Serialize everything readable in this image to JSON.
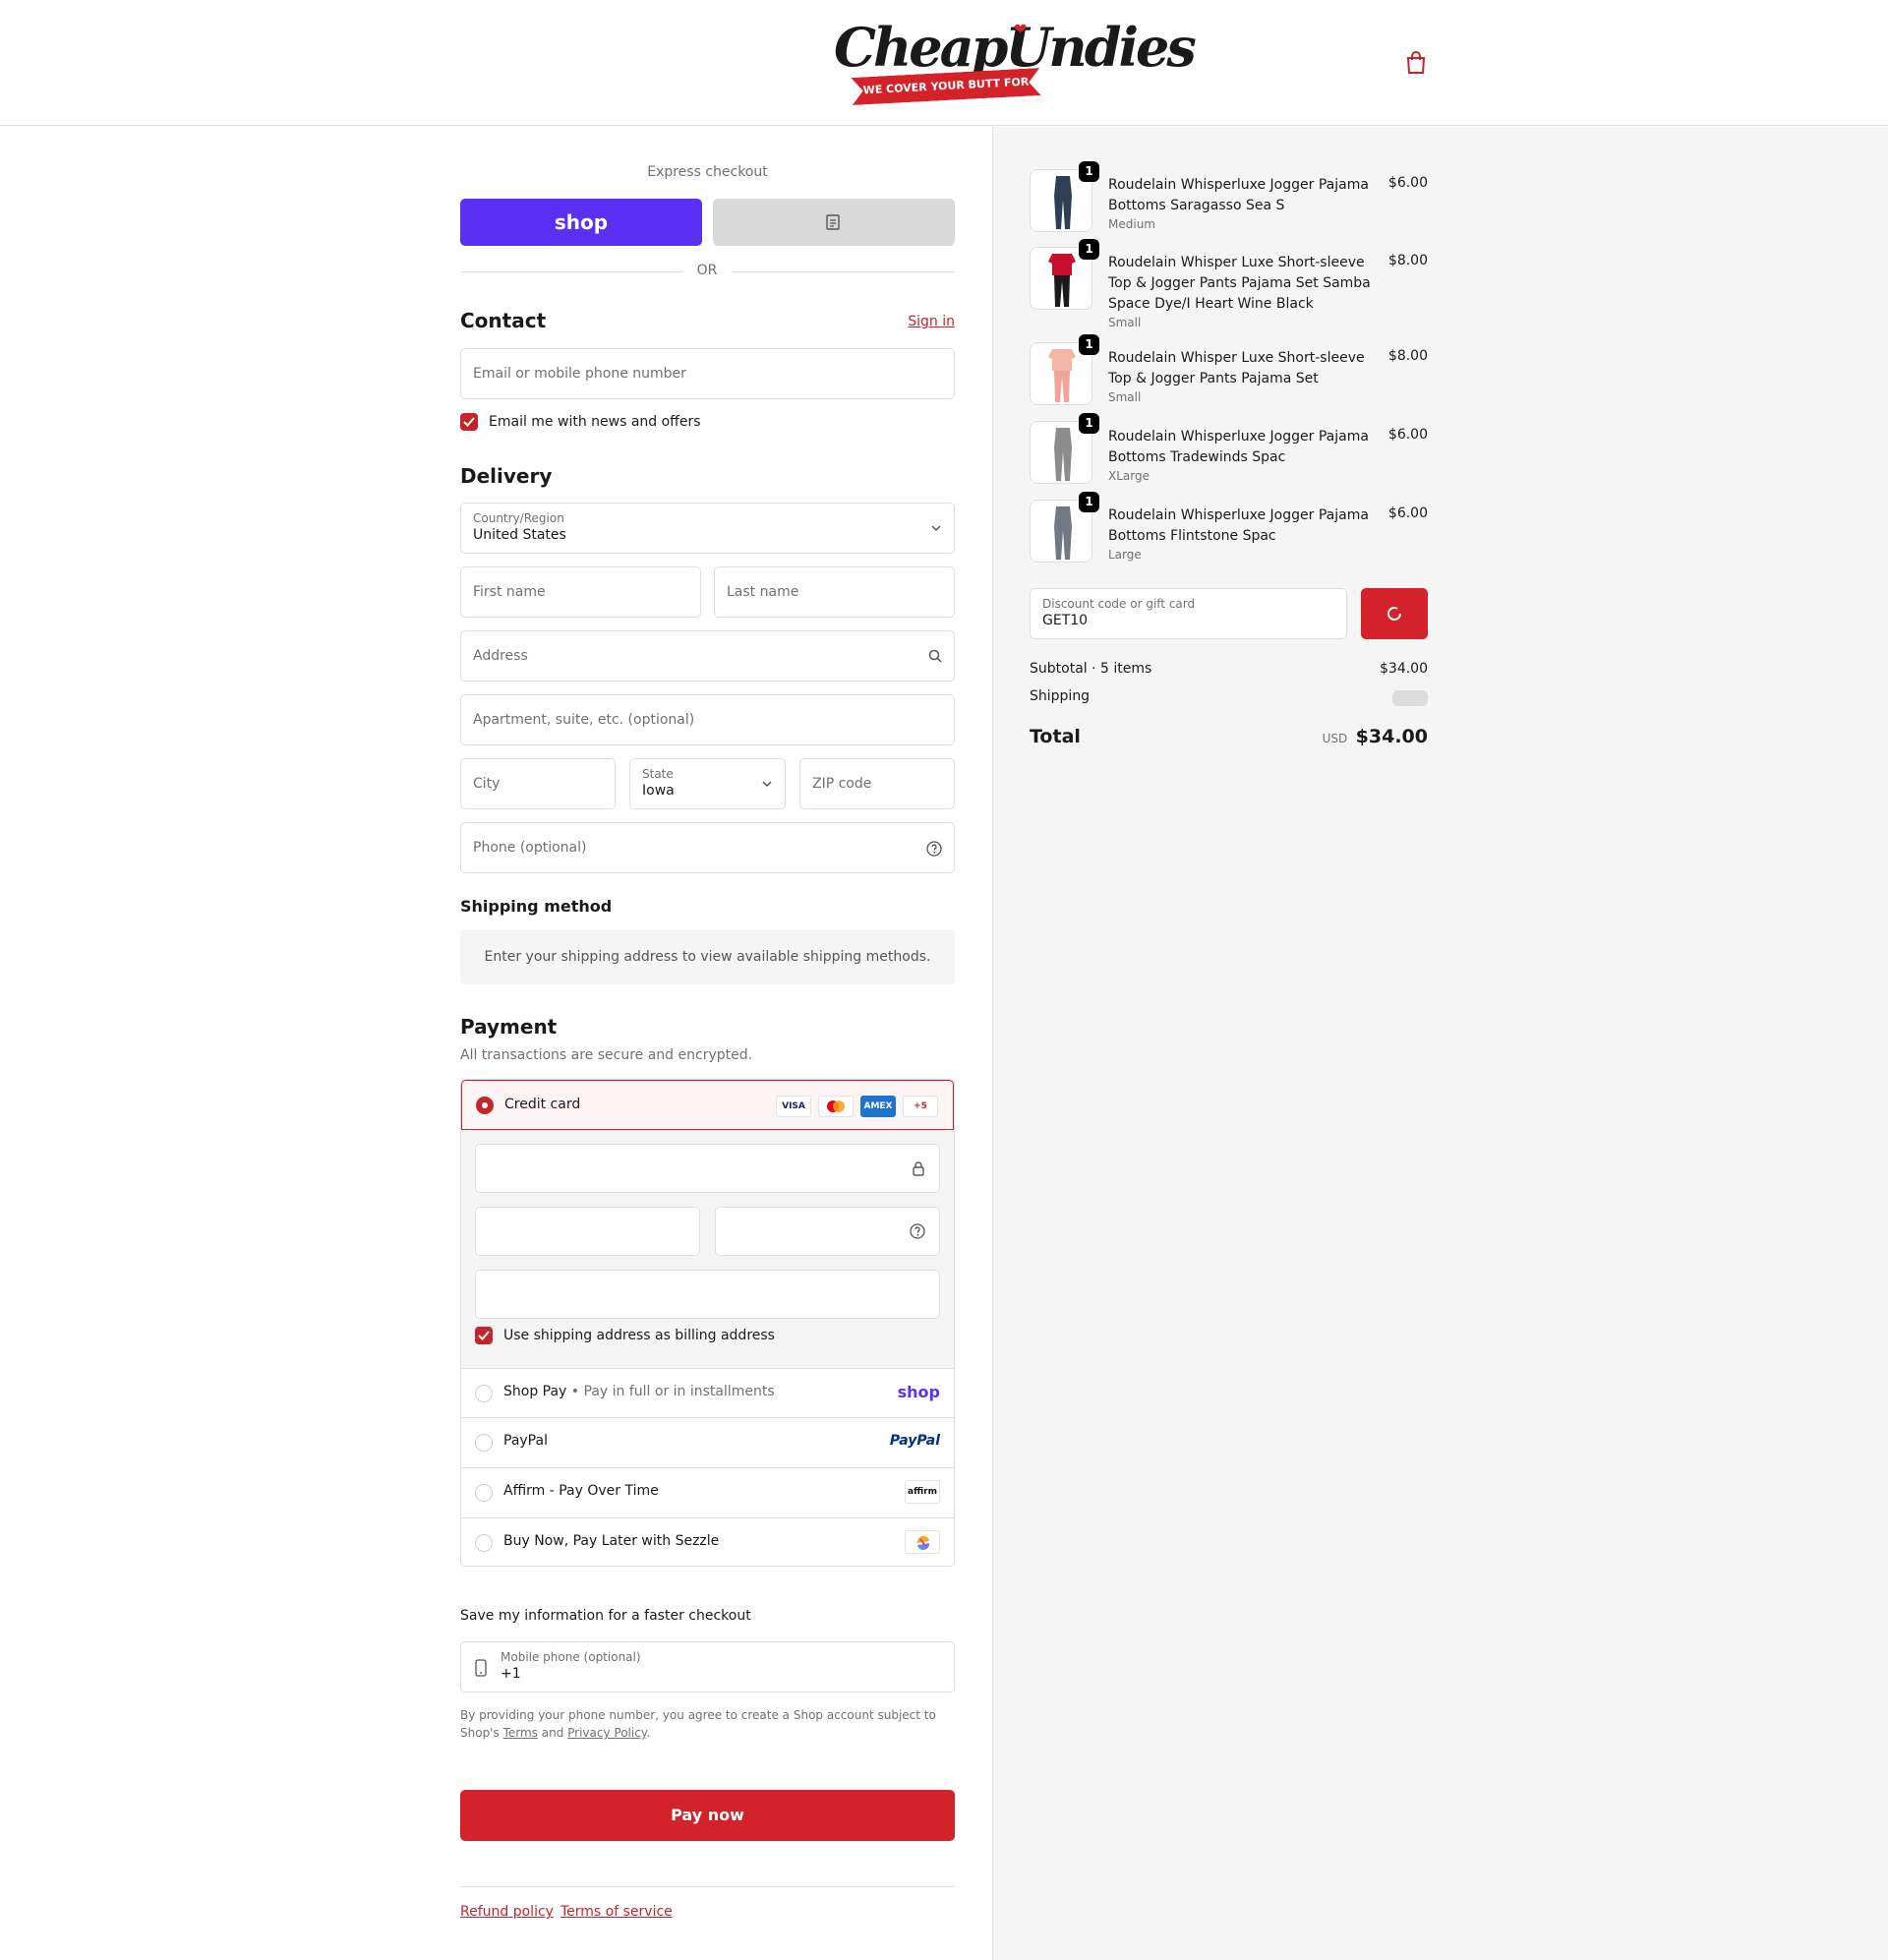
{
  "header": {
    "logo_text": "CheapUndies",
    "logo_tagline": "WE COVER YOUR BUTT FOR LESS"
  },
  "express": {
    "label": "Express checkout",
    "shop_pay_label": "shop",
    "divider": "OR"
  },
  "contact": {
    "title": "Contact",
    "sign_in": "Sign in",
    "email_placeholder": "Email or mobile phone number",
    "news_label": "Email me with news and offers"
  },
  "delivery": {
    "title": "Delivery",
    "country_label": "Country/Region",
    "country_value": "United States",
    "first_name_placeholder": "First name",
    "last_name_placeholder": "Last name",
    "address_placeholder": "Address",
    "apartment_placeholder": "Apartment, suite, etc. (optional)",
    "city_placeholder": "City",
    "state_label": "State",
    "state_value": "Iowa",
    "zip_placeholder": "ZIP code",
    "phone_placeholder": "Phone (optional)"
  },
  "shipping": {
    "title": "Shipping method",
    "message": "Enter your shipping address to view available shipping methods."
  },
  "payment": {
    "title": "Payment",
    "subtitle": "All transactions are secure and encrypted.",
    "credit_card_label": "Credit card",
    "card_logos": [
      "VISA",
      "",
      "AMEX",
      "+5"
    ],
    "billing_label": "Use shipping address as billing address",
    "shop_pay_label": "Shop Pay",
    "shop_pay_sub": "Pay in full or in installments",
    "shop_pay_logo": "shop",
    "paypal_label": "PayPal",
    "paypal_logo": "PayPal",
    "affirm_label": "Affirm - Pay Over Time",
    "affirm_logo": "affirm",
    "sezzle_label": "Buy Now, Pay Later with Sezzle"
  },
  "save_info": {
    "title": "Save my information for a faster checkout",
    "mobile_label": "Mobile phone (optional)",
    "mobile_value": "+1",
    "legal_prefix": "By providing your phone number, you agree to create a Shop account subject to Shop's",
    "terms": "Terms",
    "and": "and",
    "privacy": "Privacy Policy",
    "period": "."
  },
  "pay_now": "Pay now",
  "footer": {
    "refund": "Refund policy",
    "terms": "Terms of service"
  },
  "order": {
    "items": [
      {
        "qty": "1",
        "name": "Roudelain Whisperluxe Jogger Pajama Bottoms Saragasso Sea S",
        "variant": "Medium",
        "price": "$6.00",
        "color": "#2e3e55"
      },
      {
        "qty": "1",
        "name": "Roudelain Whisper Luxe Short-sleeve Top & Jogger Pants Pajama Set Samba Space Dye/I Heart Wine Black",
        "variant": "Small",
        "price": "$8.00",
        "color": "#c8102e"
      },
      {
        "qty": "1",
        "name": "Roudelain Whisper Luxe Short-sleeve Top & Jogger Pants Pajama Set",
        "variant": "Small",
        "price": "$8.00",
        "color": "#f2b5a8"
      },
      {
        "qty": "1",
        "name": "Roudelain Whisperluxe Jogger Pajama Bottoms Tradewinds Spac",
        "variant": "XLarge",
        "price": "$6.00",
        "color": "#8c8c8c"
      },
      {
        "qty": "1",
        "name": "Roudelain Whisperluxe Jogger Pajama Bottoms Flintstone Spac",
        "variant": "Large",
        "price": "$6.00",
        "color": "#707984"
      }
    ],
    "discount_label": "Discount code or gift card",
    "discount_value": "GET10",
    "subtotal_label": "Subtotal · 5 items",
    "subtotal_value": "$34.00",
    "shipping_label": "Shipping",
    "total_label": "Total",
    "currency": "USD",
    "total_value": "$34.00"
  },
  "colors": {
    "accent": "#d3222a",
    "shop_pay": "#5a31f4",
    "panel_bg": "#f5f5f5"
  }
}
